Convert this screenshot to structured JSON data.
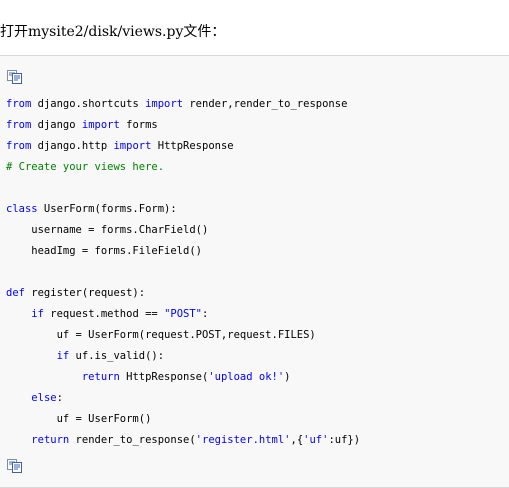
{
  "intro_text": "打开mysite2/disk/views.py文件：",
  "icons": {
    "copy_top": "view-code-icon",
    "copy_bottom": "copy-code-icon"
  },
  "colors": {
    "keyword": "#0000ff",
    "comment": "#008200",
    "string": "#0000ff",
    "code_bg": "#f8f8f8"
  },
  "code_lines": [
    [
      {
        "t": "from",
        "c": "kw"
      },
      {
        "t": " django.shortcuts "
      },
      {
        "t": "import",
        "c": "kw"
      },
      {
        "t": " render,render_to_response"
      }
    ],
    [
      {
        "t": "from",
        "c": "kw"
      },
      {
        "t": " django "
      },
      {
        "t": "import",
        "c": "kw"
      },
      {
        "t": " forms"
      }
    ],
    [
      {
        "t": "from",
        "c": "kw"
      },
      {
        "t": " django.http "
      },
      {
        "t": "import",
        "c": "kw"
      },
      {
        "t": " HttpResponse"
      }
    ],
    [
      {
        "t": "# Create your views here.",
        "c": "cm"
      }
    ],
    [],
    [
      {
        "t": "class",
        "c": "kw"
      },
      {
        "t": " UserForm(forms.Form):"
      }
    ],
    [
      {
        "t": "    username = forms.CharField()"
      }
    ],
    [
      {
        "t": "    headImg = forms.FileField()"
      }
    ],
    [],
    [
      {
        "t": "def",
        "c": "kw"
      },
      {
        "t": " register(request):"
      }
    ],
    [
      {
        "t": "    "
      },
      {
        "t": "if",
        "c": "kw"
      },
      {
        "t": " request.method == "
      },
      {
        "t": "\"POST\"",
        "c": "st"
      },
      {
        "t": ":"
      }
    ],
    [
      {
        "t": "        uf = UserForm(request.POST,request.FILES)"
      }
    ],
    [
      {
        "t": "        "
      },
      {
        "t": "if",
        "c": "kw"
      },
      {
        "t": " uf.is_valid():"
      }
    ],
    [
      {
        "t": "            "
      },
      {
        "t": "return",
        "c": "kw"
      },
      {
        "t": " HttpResponse("
      },
      {
        "t": "'upload ok!'",
        "c": "st"
      },
      {
        "t": ")"
      }
    ],
    [
      {
        "t": "    "
      },
      {
        "t": "else",
        "c": "kw"
      },
      {
        "t": ":"
      }
    ],
    [
      {
        "t": "        uf = UserForm()"
      }
    ],
    [
      {
        "t": "    "
      },
      {
        "t": "return",
        "c": "kw"
      },
      {
        "t": " render_to_response("
      },
      {
        "t": "'register.html'",
        "c": "st"
      },
      {
        "t": ",{"
      },
      {
        "t": "'uf'",
        "c": "st"
      },
      {
        "t": ":uf})"
      }
    ]
  ]
}
